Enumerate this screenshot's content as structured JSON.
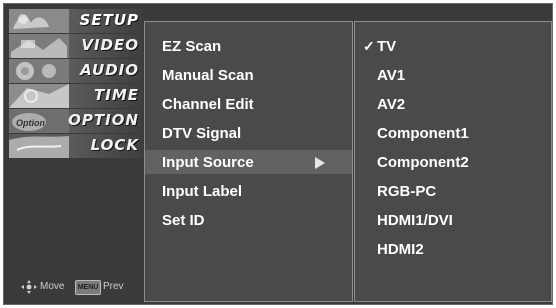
{
  "nav": {
    "items": [
      {
        "label": "SETUP",
        "active": true
      },
      {
        "label": "VIDEO"
      },
      {
        "label": "AUDIO"
      },
      {
        "label": "TIME"
      },
      {
        "label": "OPTION"
      },
      {
        "label": "LOCK"
      }
    ],
    "icon_text_option": "Option"
  },
  "footer": {
    "move_label": "Move",
    "menu_key": "MENU",
    "prev_label": "Prev"
  },
  "submenu": {
    "items": [
      {
        "label": "EZ Scan"
      },
      {
        "label": "Manual Scan"
      },
      {
        "label": "Channel Edit"
      },
      {
        "label": "DTV Signal"
      },
      {
        "label": "Input Source",
        "selected": true,
        "has_submenu": true
      },
      {
        "label": "Input Label"
      },
      {
        "label": "Set ID"
      }
    ]
  },
  "options": {
    "check_mark": "✓",
    "items": [
      {
        "label": "TV",
        "checked": true
      },
      {
        "label": "AV1"
      },
      {
        "label": "AV2"
      },
      {
        "label": "Component1"
      },
      {
        "label": "Component2"
      },
      {
        "label": "RGB-PC"
      },
      {
        "label": "HDMI1/DVI"
      },
      {
        "label": "HDMI2"
      }
    ]
  }
}
